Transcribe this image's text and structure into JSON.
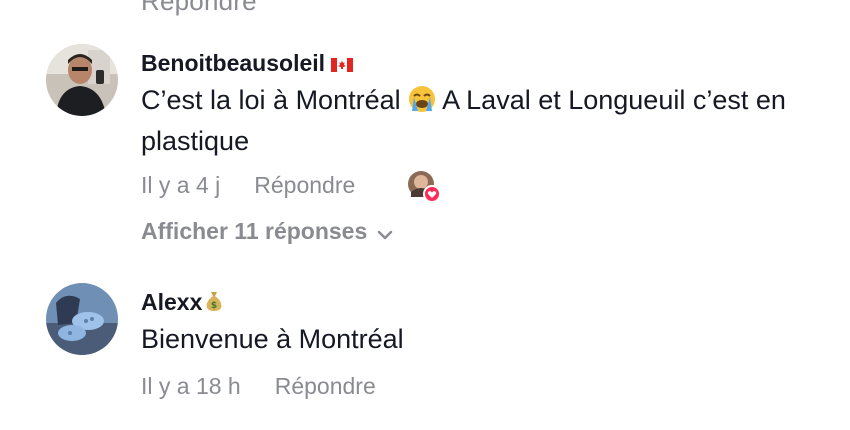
{
  "previous_comment": {
    "cut_text": "Répondre"
  },
  "comments": [
    {
      "username": "Benoitbeausoleil",
      "badge_icon": "canada-flag-icon",
      "text_before_emoji": "C’est la loi à Montréal ",
      "emoji_icon": "loudly-crying-face-icon",
      "text_after_emoji": " A Laval et Longueuil c’est en plastique",
      "time": "Il y a 4 j",
      "reply_label": "Répondre",
      "liked_by_creator": true,
      "view_replies_label": "Afficher 11 réponses"
    },
    {
      "username": "Alexx",
      "badge_icon": "money-bag-icon",
      "text": "Bienvenue à Montréal",
      "time": "Il y a 18 h",
      "reply_label": "Répondre"
    }
  ],
  "colors": {
    "primary_text": "#161823",
    "secondary_text": "#8a8b91",
    "like_heart": "#fe2c55"
  }
}
